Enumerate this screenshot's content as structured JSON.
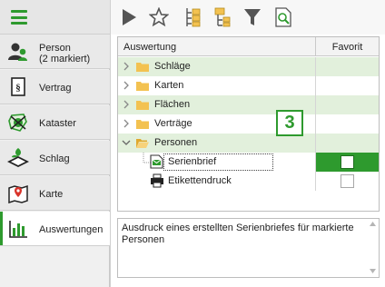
{
  "colors": {
    "accent": "#2e9a2e",
    "row_alt": "#e2f0dc",
    "folder": "#f3c251"
  },
  "sidebar": {
    "menu_icon": "hamburger-icon",
    "items": [
      {
        "label": "Person\n(2 markiert)",
        "icon": "person-icon",
        "active": false
      },
      {
        "label": "Vertrag",
        "icon": "contract-icon",
        "active": false
      },
      {
        "label": "Kataster",
        "icon": "cadastre-icon",
        "active": false
      },
      {
        "label": "Schlag",
        "icon": "field-icon",
        "active": false
      },
      {
        "label": "Karte",
        "icon": "map-icon",
        "active": false
      },
      {
        "label": "Auswertungen",
        "icon": "chart-icon",
        "active": true
      }
    ]
  },
  "toolbar": {
    "buttons": [
      "play-icon",
      "star-icon",
      "expand-tree-icon",
      "collapse-tree-icon",
      "filter-icon",
      "preview-icon"
    ]
  },
  "grid": {
    "header": {
      "col_name": "Auswertung",
      "col_fav": "Favorit"
    },
    "rows": [
      {
        "label": "Schläge",
        "type": "folder",
        "expanded": false
      },
      {
        "label": "Karten",
        "type": "folder",
        "expanded": false
      },
      {
        "label": "Flächen",
        "type": "folder",
        "expanded": false
      },
      {
        "label": "Verträge",
        "type": "folder",
        "expanded": false
      },
      {
        "label": "Personen",
        "type": "folder",
        "expanded": true
      },
      {
        "label": "Serienbrief",
        "type": "report",
        "favorite": false,
        "selected": true
      },
      {
        "label": "Etikettendruck",
        "type": "print",
        "favorite": false,
        "selected": false
      }
    ]
  },
  "callout": {
    "number": "3"
  },
  "description": {
    "text": "Ausdruck eines erstellten Serienbriefes für markierte Personen"
  }
}
